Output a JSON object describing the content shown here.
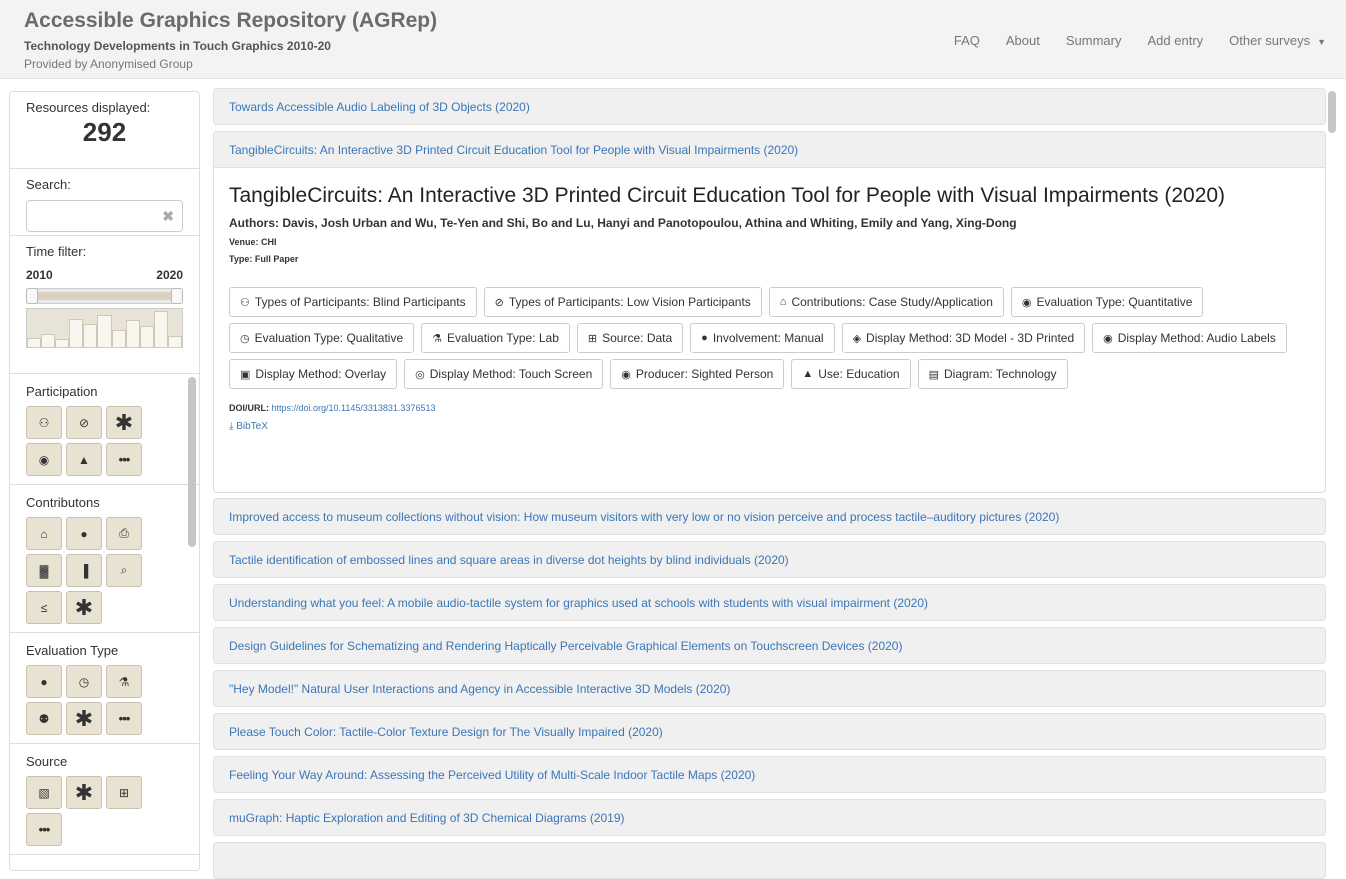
{
  "navbar": {
    "title": "Accessible Graphics Repository (AGRep)",
    "subtitle": "Technology Developments in Touch Graphics 2010-20",
    "provider": "Provided by Anonymised Group",
    "links": [
      "FAQ",
      "About",
      "Summary",
      "Add entry",
      "Other surveys"
    ]
  },
  "sidebar": {
    "resources_label": "Resources displayed:",
    "resources_count": "292",
    "search_label": "Search:",
    "search_value": "",
    "time_label": "Time filter:",
    "time_start": "2010",
    "time_end": "2020",
    "histogram": [
      0.25,
      0.35,
      0.2,
      0.75,
      0.6,
      0.85,
      0.45,
      0.7,
      0.55,
      0.95,
      0.3
    ]
  },
  "categories": [
    {
      "title": "Participation",
      "icons": [
        "walking-person-icon",
        "eye-slash-icon",
        "asterisk-icon",
        "eye-icon",
        "user-icon",
        "ellipsis-icon"
      ]
    },
    {
      "title": "Contributons",
      "icons": [
        "institution-icon",
        "comments-icon",
        "printer-icon",
        "industry-icon",
        "signal-icon",
        "search-icon",
        "less-equal-icon",
        "asterisk-icon"
      ]
    },
    {
      "title": "Evaluation Type",
      "icons": [
        "comments-icon",
        "stopwatch-icon",
        "flask-icon",
        "people-icon",
        "asterisk-icon",
        "ellipsis-icon"
      ]
    },
    {
      "title": "Source",
      "icons": [
        "images-icon",
        "asterisk-icon",
        "table-icon",
        "ellipsis-icon"
      ]
    }
  ],
  "list": [
    "Towards Accessible Audio Labeling of 3D Objects (2020)",
    "TangibleCircuits: An Interactive 3D Printed Circuit Education Tool for People with Visual Impairments (2020)",
    "Improved access to museum collections without vision: How museum visitors with very low or no vision perceive and process tactile–auditory pictures (2020)",
    "Tactile identification of embossed lines and square areas in diverse dot heights by blind individuals (2020)",
    "Understanding what you feel: A mobile audio-tactile system for graphics used at schools with students with visual impairment (2020)",
    "Design Guidelines for Schematizing and Rendering Haptically Perceivable Graphical Elements on Touchscreen Devices (2020)",
    "\"Hey Model!\" Natural User Interactions and Agency in Accessible Interactive 3D Models (2020)",
    "Please Touch Color: Tactile-Color Texture Design for The Visually Impaired (2020)",
    "Feeling Your Way Around: Assessing the Perceived Utility of Multi-Scale Indoor Tactile Maps (2020)",
    "muGraph: Haptic Exploration and Editing of 3D Chemical Diagrams (2019)",
    ""
  ],
  "detail": {
    "title": "TangibleCircuits: An Interactive 3D Printed Circuit Education Tool for People with Visual Impairments (2020)",
    "authors": "Authors: Davis, Josh Urban and Wu, Te-Yen and Shi, Bo and Lu, Hanyi and Panotopoulou, Athina and Whiting, Emily and Yang, Xing-Dong",
    "venue": "Venue: CHI",
    "type": "Type: Full Paper",
    "tags": [
      {
        "icon": "walking-person-icon",
        "glyph": "⚇",
        "label": "Types of Participants: Blind Participants"
      },
      {
        "icon": "eye-slash-icon",
        "glyph": "⊘",
        "label": "Types of Participants: Low Vision Participants"
      },
      {
        "icon": "institution-icon",
        "glyph": "⌂",
        "label": "Contributions: Case Study/Application"
      },
      {
        "icon": "comments-icon",
        "glyph": "◉",
        "label": "Evaluation Type: Quantitative"
      },
      {
        "icon": "stopwatch-icon",
        "glyph": "◷",
        "label": "Evaluation Type: Qualitative"
      },
      {
        "icon": "flask-icon",
        "glyph": "⚗",
        "label": "Evaluation Type: Lab"
      },
      {
        "icon": "table-icon",
        "glyph": "⊞",
        "label": "Source: Data"
      },
      {
        "icon": "user-icon",
        "glyph": "●",
        "label": "Involvement: Manual"
      },
      {
        "icon": "cube-icon",
        "glyph": "◈",
        "label": "Display Method: 3D Model - 3D Printed"
      },
      {
        "icon": "audio-icon",
        "glyph": "◉",
        "label": "Display Method: Audio Labels"
      },
      {
        "icon": "copy-icon",
        "glyph": "▣",
        "label": "Display Method: Overlay"
      },
      {
        "icon": "fingerprint-icon",
        "glyph": "◎",
        "label": "Display Method: Touch Screen"
      },
      {
        "icon": "eye-icon",
        "glyph": "◉",
        "label": "Producer: Sighted Person"
      },
      {
        "icon": "graduation-cap-icon",
        "glyph": "▲",
        "label": "Use: Education"
      },
      {
        "icon": "chalkboard-icon",
        "glyph": "▤",
        "label": "Diagram: Technology"
      }
    ],
    "doi_label": "DOI/URL: ",
    "doi_url": "https://doi.org/10.1145/3313831.3376513",
    "bibtex": "BibTeX"
  }
}
